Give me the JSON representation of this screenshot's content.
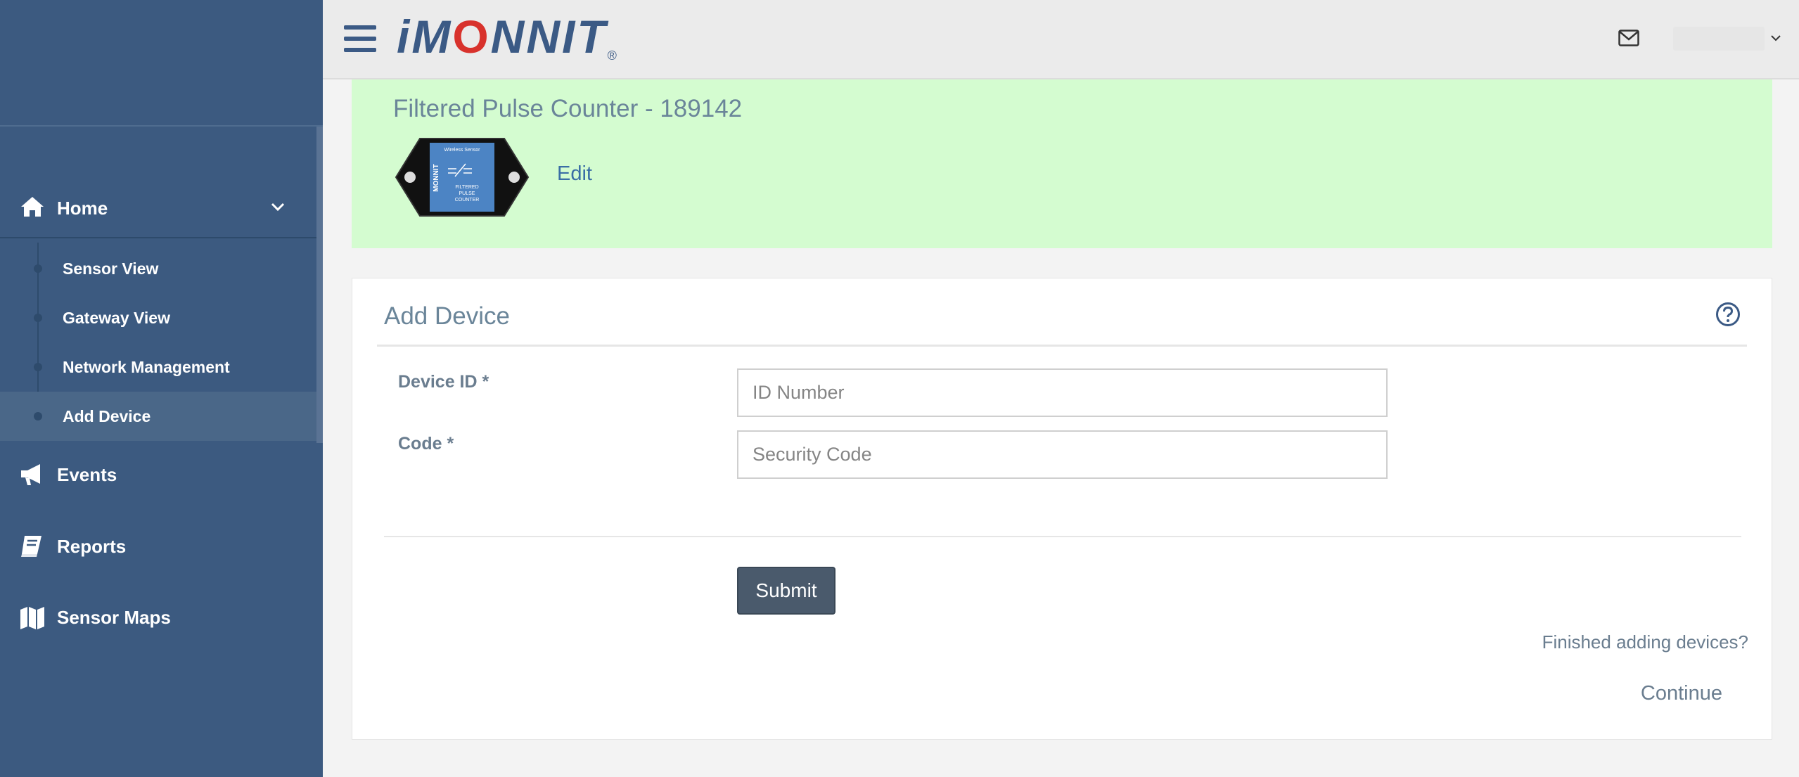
{
  "topbar": {
    "brand": {
      "prefix": "iM",
      "o": "O",
      "suffix": "NNIT",
      "reg": "®"
    },
    "mail_icon": "envelope-icon",
    "menu_icon": "hamburger-icon"
  },
  "sidebar": {
    "home": {
      "label": "Home",
      "icon": "home-icon"
    },
    "sub_items": [
      {
        "label": "Sensor View"
      },
      {
        "label": "Gateway View"
      },
      {
        "label": "Network Management"
      },
      {
        "label": "Add Device",
        "active": true
      }
    ],
    "main_items": [
      {
        "label": "Events",
        "icon": "megaphone-icon"
      },
      {
        "label": "Reports",
        "icon": "book-icon"
      },
      {
        "label": "Sensor Maps",
        "icon": "map-icon"
      }
    ]
  },
  "banner": {
    "title": "Filtered Pulse Counter - 189142",
    "edit_label": "Edit",
    "device_image": {
      "brand": "MONNIT",
      "top_text": "Wireless Sensor",
      "lines": [
        "FILTERED",
        "PULSE",
        "COUNTER"
      ]
    }
  },
  "form": {
    "title": "Add Device",
    "help_icon": "question-circle-icon",
    "device_id": {
      "label": "Device ID *",
      "placeholder": "ID Number",
      "value": ""
    },
    "code": {
      "label": "Code *",
      "placeholder": "Security Code",
      "value": ""
    },
    "submit_label": "Submit",
    "finished_text": "Finished adding devices?",
    "continue_label": "Continue"
  },
  "colors": {
    "sidebar_bg": "#3c5a80",
    "banner_bg": "#d4fcd0",
    "brand_blue": "#3b5a85",
    "brand_red": "#d8322c",
    "button_bg": "#4a5a6c"
  }
}
